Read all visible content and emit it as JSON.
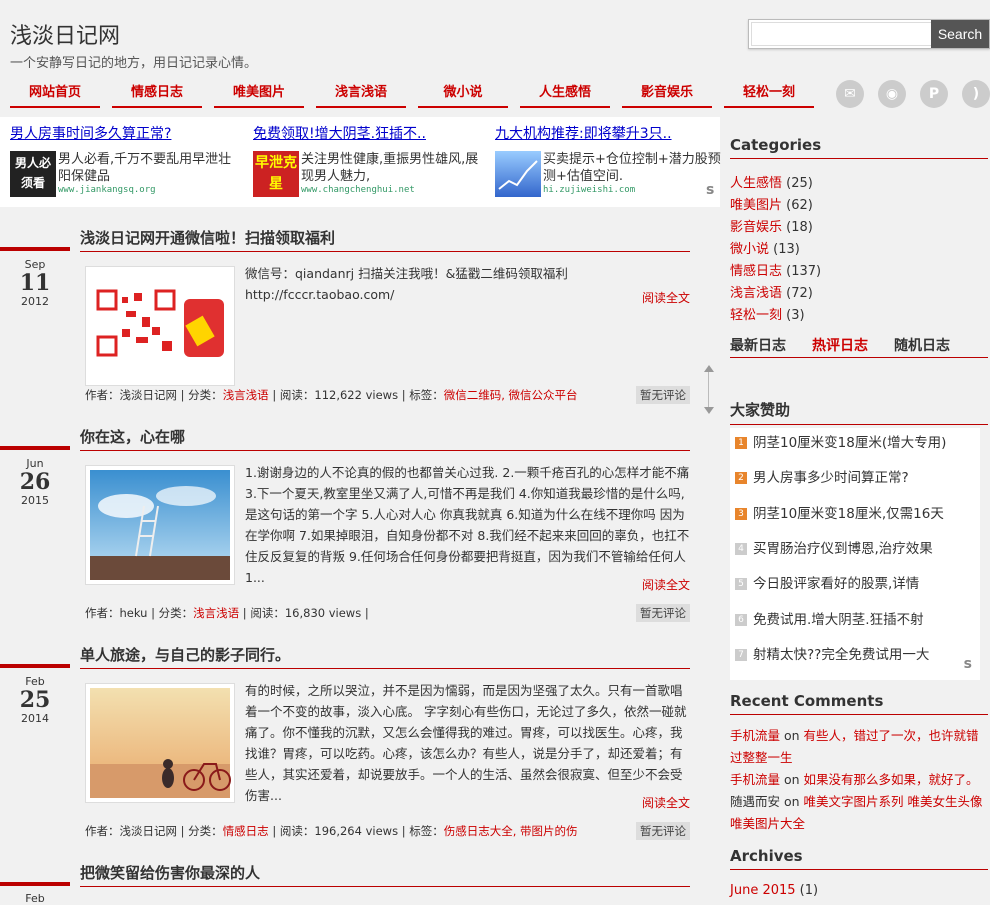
{
  "header": {
    "title": "浅淡日记网",
    "tagline": "一个安静写日记的地方，用日记记录心情。",
    "search_placeholder": "",
    "search_label": "Search"
  },
  "nav": [
    "网站首页",
    "情感日志",
    "唯美图片",
    "浅言浅语",
    "微小说",
    "人生感悟",
    "影音娱乐",
    "轻松一刻"
  ],
  "social_icons": [
    "mail-icon",
    "weibo-icon",
    "pinterest-icon",
    "rss-icon"
  ],
  "ads": [
    {
      "title": "男人房事时间多久算正常?",
      "thumb_text": "男人必须看",
      "text": "男人必看,千万不要乱用早泄壮阳保健品",
      "url": "www.jiankangsq.org"
    },
    {
      "title": "免费领取!增大阴茎.狂插不..",
      "thumb_text": "早泄克星",
      "text": "关注男性健康,重振男性雄风,展现男人魅力,",
      "url": "www.changchenghui.net"
    },
    {
      "title": "九大机构推荐:即将攀升3只..",
      "thumb_text": "",
      "text": "买卖提示+仓位控制+潜力股预测+估值空间.",
      "url": "hi.zujiweishi.com"
    }
  ],
  "ad_mark": "s",
  "posts": [
    {
      "title": "浅淡日记网开通微信啦！扫描领取福利",
      "month": "Sep",
      "day": "11",
      "year": "2012",
      "excerpt": "微信号：qiandanrj  扫描关注我哦！&猛戳二维码领取福利 http://fcccr.taobao.com/",
      "read_more": "阅读全文",
      "meta_prefix": "作者：浅淡日记网 | 分类：",
      "category": "浅言浅语",
      "meta_mid": " | 阅读：112,622 views | 标签：",
      "tags": "微信二维码, 微信公众平台",
      "comments": "暂无评论"
    },
    {
      "title": "你在这，心在哪",
      "month": "Jun",
      "day": "26",
      "year": "2015",
      "excerpt": "1.谢谢身边的人不论真的假的也都曾关心过我. 2.一颗千疮百孔的心怎样才能不痛 3.下一个夏天,教室里坐又满了人,可惜不再是我们 4.你知道我最珍惜的是什么吗,是这句话的第一个字 5.人心对人心 你真我就真 6.知道为什么在线不理你吗 因为在学你啊 7.如果掉眼泪，自知身份都不对 8.我们经不起来来回回的辜负，也扛不住反反复复的背叛 9.任何场合任何身份都要把背挺直，因为我们不管输给任何人 1...",
      "read_more": "阅读全文",
      "meta_prefix": "作者：heku | 分类：",
      "category": "浅言浅语",
      "meta_mid": " | 阅读：16,830 views |",
      "tags": "",
      "comments": "暂无评论"
    },
    {
      "title": "单人旅途，与自己的影子同行。",
      "month": "Feb",
      "day": "25",
      "year": "2014",
      "excerpt": "有的时候，之所以哭泣，并不是因为懦弱，而是因为坚强了太久。只有一首歌唱着一个不变的故事，淡入心底。 字字刻心有些伤口，无论过了多久，依然一碰就痛了。你不懂我的沉默，又怎么会懂得我的难过。胃疼，可以找医生。心疼，我找谁？胃疼，可以吃药。心疼，该怎么办？有些人，说是分手了，却还爱着；有些人，其实还爱着，却说要放手。一个人的生活、虽然会很寂寞、但至少不会受伤害...",
      "read_more": "阅读全文",
      "meta_prefix": "作者：浅淡日记网 | 分类：",
      "category": "情感日志",
      "meta_mid": " | 阅读：196,264 views | 标签：",
      "tags": "伤感日志大全, 带图片的伤",
      "comments": "暂无评论"
    },
    {
      "title": "把微笑留给伤害你最深的人",
      "month": "Feb",
      "day": "",
      "year": ""
    }
  ],
  "sidebar": {
    "categories_title": "Categories",
    "categories": [
      {
        "name": "人生感悟",
        "count": "(25)"
      },
      {
        "name": "唯美图片",
        "count": "(62)"
      },
      {
        "name": "影音娱乐",
        "count": "(18)"
      },
      {
        "name": "微小说",
        "count": "(13)"
      },
      {
        "name": "情感日志",
        "count": "(137)"
      },
      {
        "name": "浅言浅语",
        "count": "(72)"
      },
      {
        "name": "轻松一刻",
        "count": "(3)"
      }
    ],
    "tabs": [
      "最新日志",
      "热评日志",
      "随机日志"
    ],
    "sponsor_title": "大家赞助",
    "sponsor_items": [
      {
        "num": "1",
        "text": "阴茎10厘米变18厘米(增大专用)",
        "color": "#e8852c"
      },
      {
        "num": "2",
        "text": "男人房事多少时间算正常?",
        "color": "#e8852c"
      },
      {
        "num": "3",
        "text": "阴茎10厘米变18厘米,仅需16天",
        "color": "#e8852c"
      },
      {
        "num": "4",
        "text": "买胃肠治疗仪到博恩,治疗效果",
        "color": "#ccc"
      },
      {
        "num": "5",
        "text": "今日股评家看好的股票,详情",
        "color": "#ccc"
      },
      {
        "num": "6",
        "text": "免费试用.增大阴茎.狂插不射",
        "color": "#ccc"
      },
      {
        "num": "7",
        "text": "射精太快??完全免费试用一大",
        "color": "#ccc"
      }
    ],
    "sponsor_mark": "s",
    "recent_comments_title": "Recent Comments",
    "recent_comments": [
      {
        "author": "手机流量",
        "on": " on ",
        "post": "有些人，错过了一次，也许就错过整整一生"
      },
      {
        "author": "手机流量",
        "on": " on ",
        "post": "如果没有那么多如果，就好了。"
      },
      {
        "author": "随遇而安",
        "on": " on ",
        "post": "唯美文字图片系列 唯美女生头像 唯美图片大全"
      }
    ],
    "archives_title": "Archives",
    "archives": [
      {
        "month": "June 2015",
        "count": "(1)"
      }
    ]
  },
  "colors": {
    "accent": "#cc0000",
    "nav_underline": "#b00000"
  }
}
